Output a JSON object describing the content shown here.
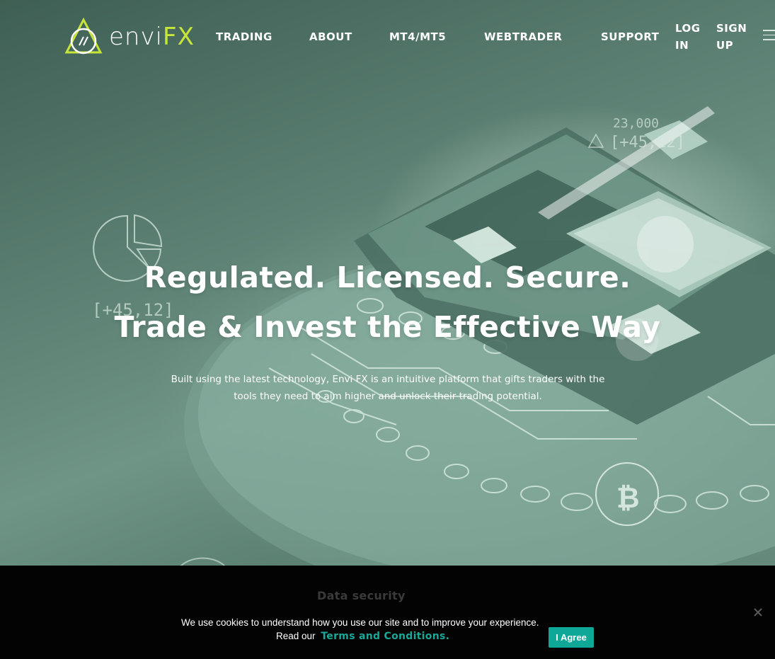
{
  "brand": {
    "name_a": "envi",
    "name_b": "FX",
    "accent": "#c8e63a"
  },
  "nav": {
    "items": [
      {
        "label": "TRADING"
      },
      {
        "label": "ABOUT"
      },
      {
        "label": "MT4/MT5"
      },
      {
        "label": "WEBTRADER"
      },
      {
        "label": "SUPPORT"
      },
      {
        "label": "LOG IN"
      },
      {
        "label": "SIGN UP"
      }
    ],
    "menu_icon": "hamburger-icon"
  },
  "hero": {
    "headline_1": "Regulated. Licensed. Secure.",
    "headline_2": "Trade & Invest the Effective Way",
    "subtext": "Built using the latest technology, Envi FX is an intuitive platform that gifts traders with the tools they need to aim higher and unlock their trading potential.",
    "deco_texts": {
      "left_value": "[+45,12]",
      "top_number": "23,000",
      "top_value": "[+45,12]"
    }
  },
  "cookie": {
    "section_title": "Data security",
    "message": "We use cookies to understand how you use our site and to improve your experience.",
    "read_our": "Read our",
    "terms_link": "Terms and Conditions.",
    "agree_label": "I Agree",
    "button_color": "#0fa898",
    "link_color": "#1aa89a"
  }
}
